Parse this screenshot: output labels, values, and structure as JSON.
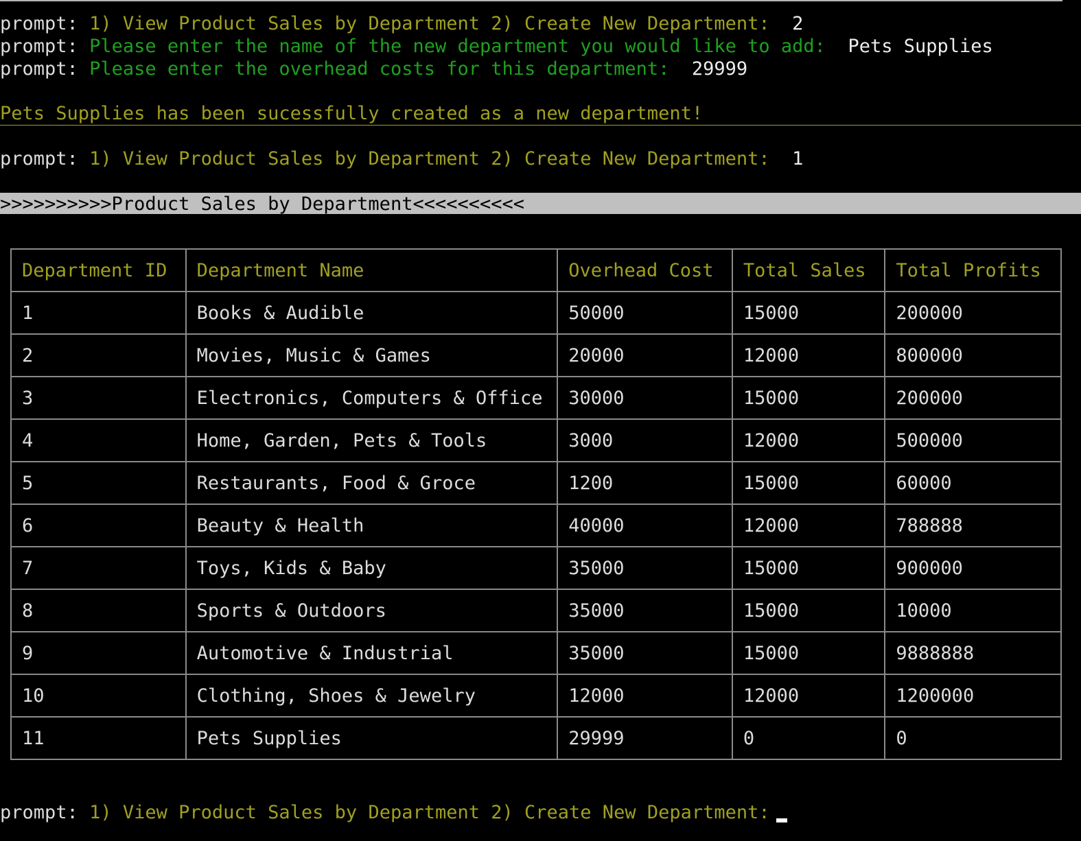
{
  "session": {
    "prompt_label": "prompt:",
    "menu_text": "1) View Product Sales by Department 2) Create New Department:",
    "lines": [
      {
        "kind": "menu",
        "answer": "2"
      },
      {
        "kind": "ask",
        "question": "Please enter the name of the new department you would like to add:",
        "answer": "Pets Supplies"
      },
      {
        "kind": "ask",
        "question": "Please enter the overhead costs for this department:",
        "answer": "29999"
      }
    ],
    "success_message": "Pets Supplies has been sucessfully created as a new department!",
    "second_menu_answer": "1",
    "banner": ">>>>>>>>>>Product Sales by Department<<<<<<<<<<",
    "final_menu_answer": ""
  },
  "table": {
    "headers": [
      "Department ID",
      "Department Name",
      "Overhead Cost",
      "Total Sales",
      "Total Profits"
    ],
    "rows": [
      [
        "1",
        "Books & Audible",
        "50000",
        "15000",
        "200000"
      ],
      [
        "2",
        "Movies, Music & Games",
        "20000",
        "12000",
        "800000"
      ],
      [
        "3",
        "Electronics, Computers & Office",
        "30000",
        "15000",
        "200000"
      ],
      [
        "4",
        "Home, Garden, Pets & Tools",
        "3000",
        "12000",
        "500000"
      ],
      [
        "5",
        "Restaurants, Food & Groce",
        "1200",
        "15000",
        "60000"
      ],
      [
        "6",
        "Beauty & Health",
        "40000",
        "12000",
        "788888"
      ],
      [
        "7",
        "Toys, Kids & Baby",
        "35000",
        "15000",
        "900000"
      ],
      [
        "8",
        "Sports & Outdoors",
        "35000",
        "15000",
        "10000"
      ],
      [
        "9",
        "Automotive & Industrial",
        "35000",
        "15000",
        "9888888"
      ],
      [
        "10",
        "Clothing, Shoes & Jewelry",
        "12000",
        "12000",
        "1200000"
      ],
      [
        "11",
        "Pets Supplies",
        "29999",
        "0",
        "0"
      ]
    ]
  },
  "colors": {
    "background": "#000000",
    "prompt_text": "#dcdcdc",
    "menu_text": "#a0a021",
    "question_text": "#1fa01f",
    "banner_bg": "#c0c0c0",
    "table_border": "#8a8a8a"
  }
}
